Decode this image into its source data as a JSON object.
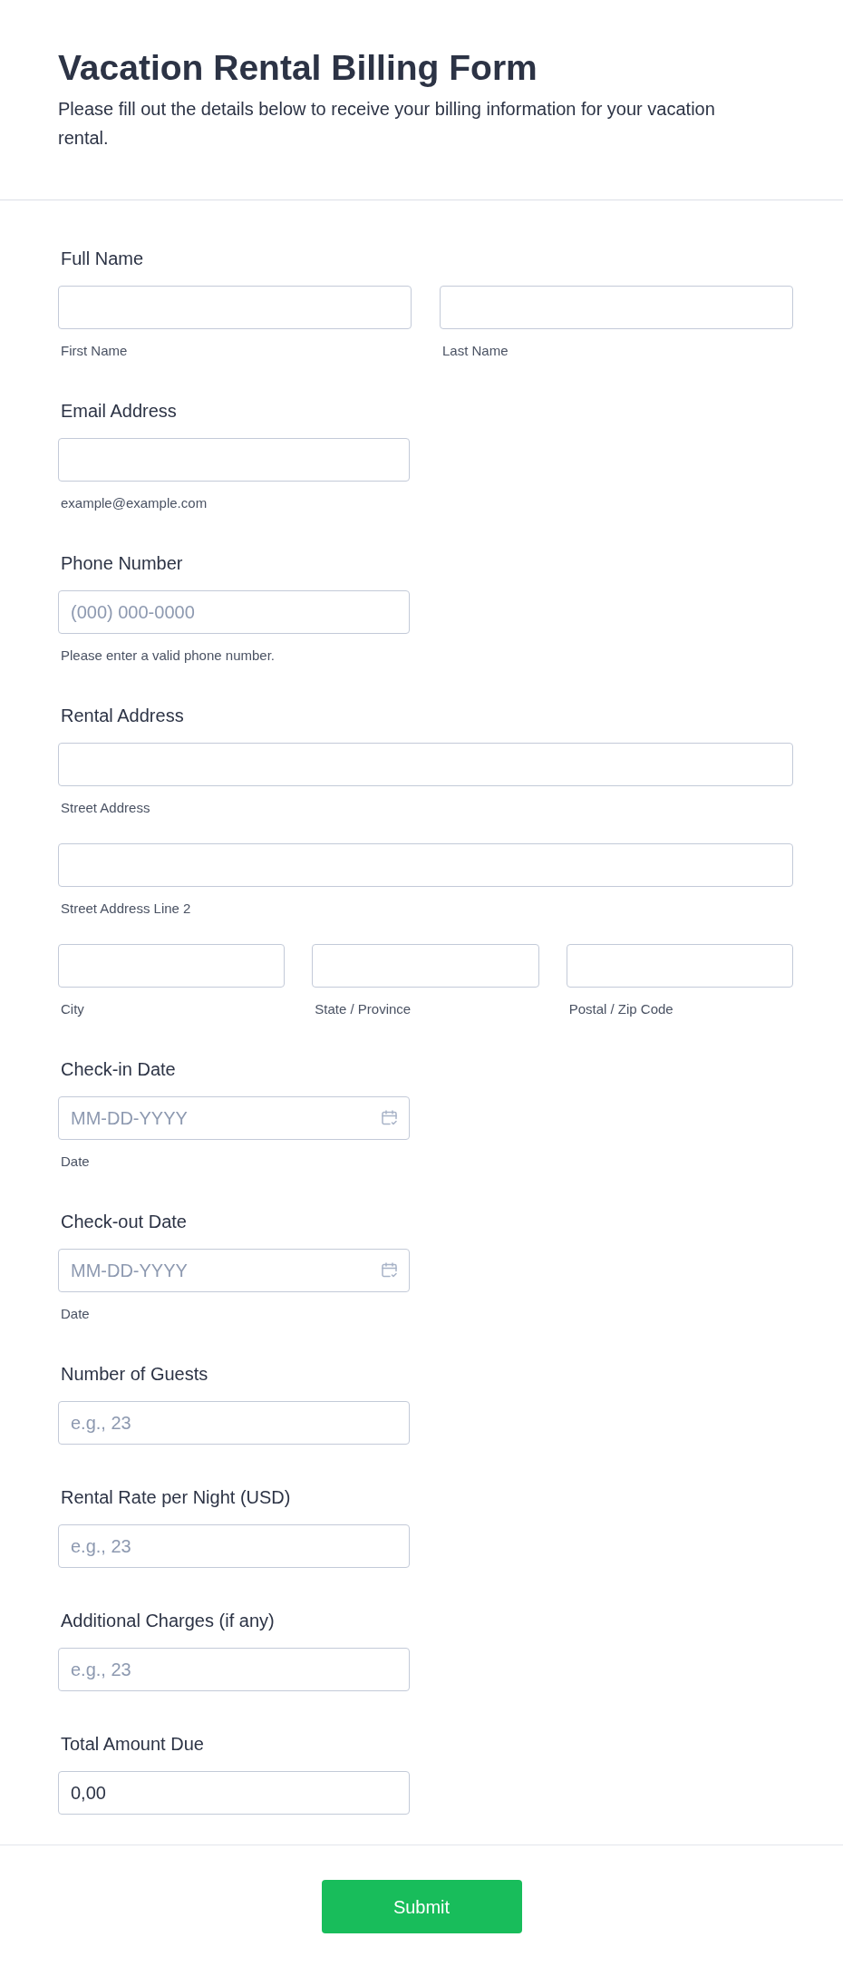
{
  "header": {
    "title": "Vacation Rental Billing Form",
    "description": "Please fill out the details below to receive your billing information for your vacation rental."
  },
  "fields": [
    {
      "kind": "name",
      "label": "Full Name",
      "inputs": [
        {
          "sublabel": "First Name"
        },
        {
          "sublabel": "Last Name"
        }
      ]
    },
    {
      "kind": "email",
      "label": "Email Address",
      "inputs": [
        {
          "sublabel": "example@example.com"
        }
      ]
    },
    {
      "kind": "phone",
      "label": "Phone Number",
      "inputs": [
        {
          "placeholder": "(000) 000-0000",
          "sublabel": "Please enter a valid phone number."
        }
      ]
    },
    {
      "kind": "address",
      "label": "Rental Address",
      "inputs": [
        {
          "sublabel": "Street Address"
        },
        {
          "sublabel": "Street Address Line 2"
        },
        {
          "sublabel": "City"
        },
        {
          "sublabel": "State / Province"
        },
        {
          "sublabel": "Postal / Zip Code"
        }
      ]
    },
    {
      "kind": "date",
      "label": "Check-in Date",
      "inputs": [
        {
          "placeholder": "MM-DD-YYYY",
          "sublabel": "Date"
        }
      ]
    },
    {
      "kind": "date",
      "label": "Check-out Date",
      "inputs": [
        {
          "placeholder": "MM-DD-YYYY",
          "sublabel": "Date"
        }
      ]
    },
    {
      "kind": "number",
      "label": "Number of Guests",
      "inputs": [
        {
          "placeholder": "e.g., 23"
        }
      ]
    },
    {
      "kind": "number",
      "label": "Rental Rate per Night (USD)",
      "inputs": [
        {
          "placeholder": "e.g., 23"
        }
      ]
    },
    {
      "kind": "number",
      "label": "Additional Charges (if any)",
      "inputs": [
        {
          "placeholder": "e.g., 23"
        }
      ]
    },
    {
      "kind": "calculation",
      "label": "Total Amount Due",
      "inputs": [
        {
          "value": "0,00"
        }
      ]
    }
  ],
  "submit": {
    "label": "Submit"
  }
}
